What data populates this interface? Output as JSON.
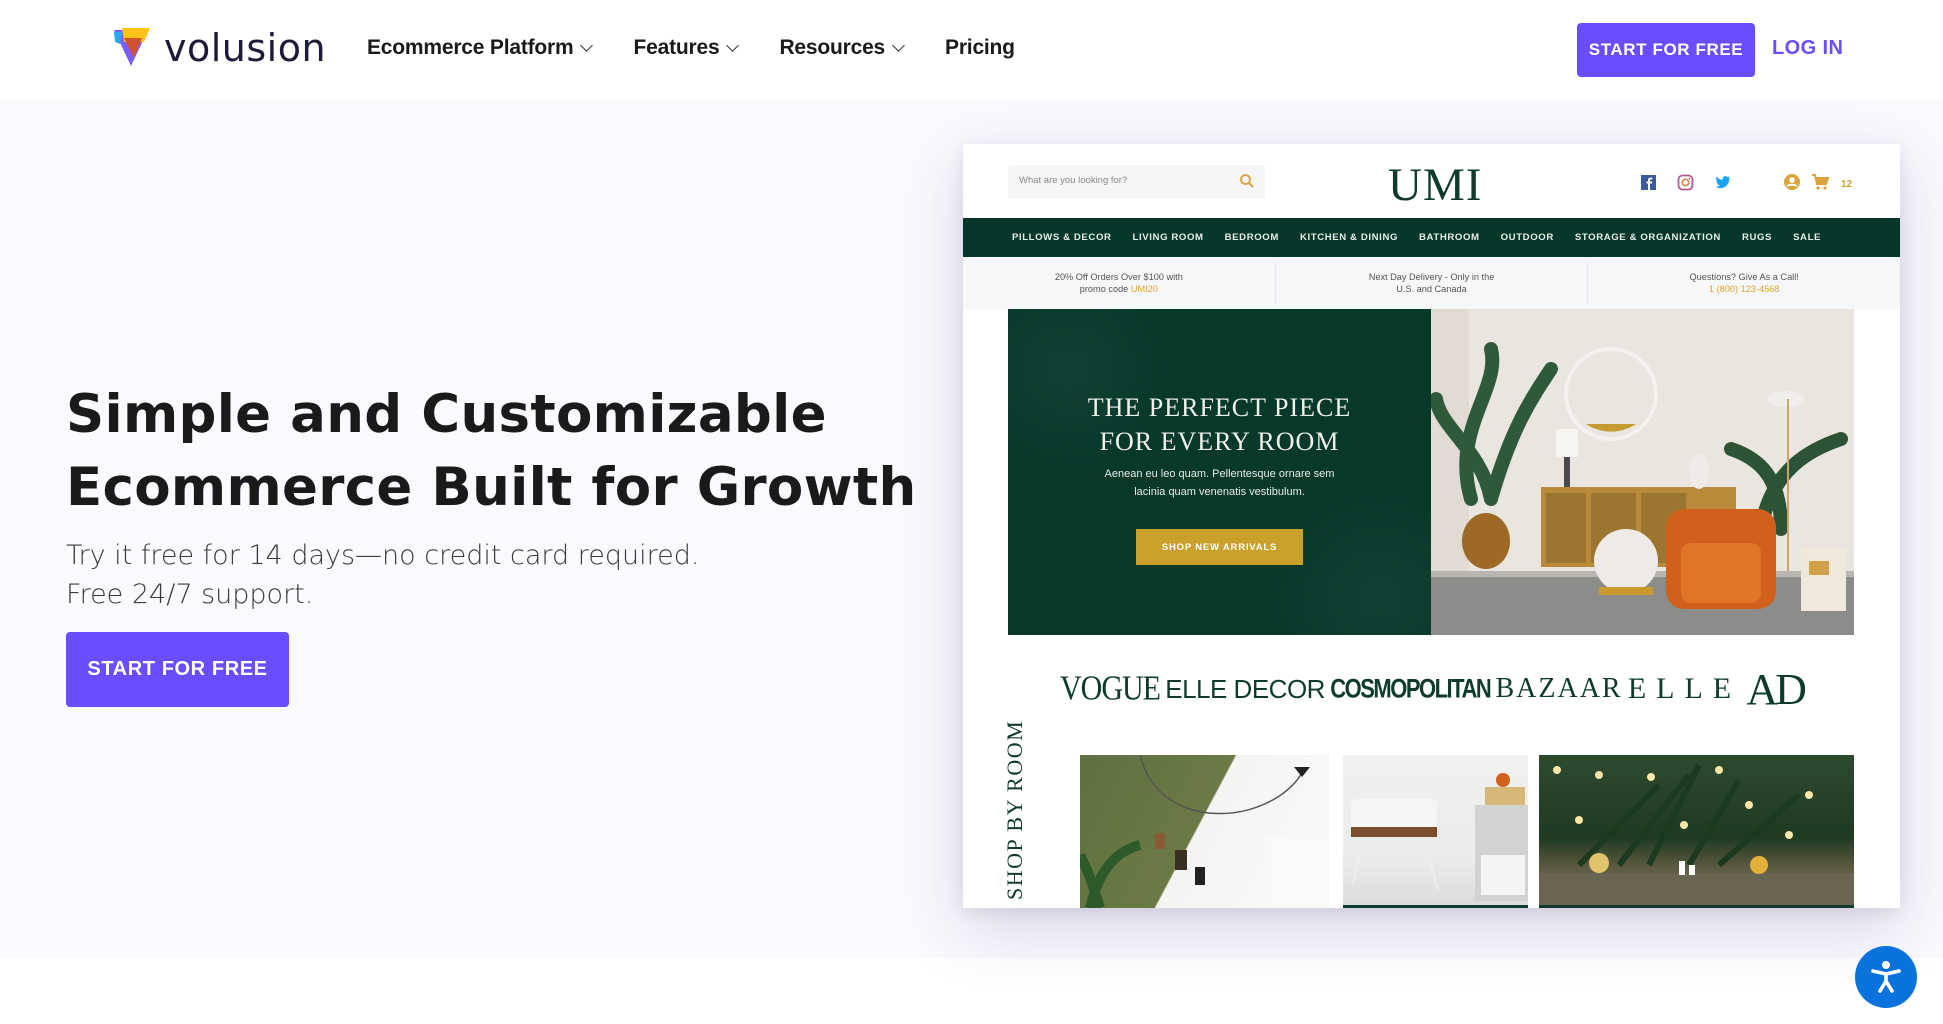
{
  "header": {
    "logo_text": "volusion",
    "nav": [
      {
        "label": "Ecommerce Platform",
        "has_dropdown": true
      },
      {
        "label": "Features",
        "has_dropdown": true
      },
      {
        "label": "Resources",
        "has_dropdown": true
      },
      {
        "label": "Pricing",
        "has_dropdown": false
      }
    ],
    "cta_label": "START FOR FREE",
    "login_label": "LOG IN"
  },
  "hero": {
    "headline_line1": "Simple and Customizable",
    "headline_line2": "Ecommerce Built for Growth",
    "sub_line1": "Try it free for 14 days—no credit card required.",
    "sub_line2": "Free 24/7 support.",
    "cta_label": "START FOR FREE"
  },
  "mockup": {
    "search_placeholder": "What are you looking for?",
    "store_logo": "UMI",
    "social_icons": [
      "facebook-icon",
      "instagram-icon",
      "twitter-icon"
    ],
    "cart_count": "12",
    "nav": [
      "PILLOWS & DECOR",
      "LIVING ROOM",
      "BEDROOM",
      "KITCHEN & DINING",
      "BATHROOM",
      "OUTDOOR",
      "STORAGE & ORGANIZATION",
      "RUGS",
      "SALE"
    ],
    "promos": [
      {
        "line1": "20% Off Orders Over $100 with",
        "line2_prefix": "promo code ",
        "line2_highlight": "UMI20"
      },
      {
        "line1": "Next Day Delivery - Only in the",
        "line2_prefix": "U.S. and Canada",
        "line2_highlight": ""
      },
      {
        "line1": "Questions? Give As a Call!",
        "line2_prefix": "",
        "line2_highlight": "1 (800) 123-4568"
      }
    ],
    "banner": {
      "title_line1": "THE PERFECT PIECE",
      "title_line2": "FOR EVERY ROOM",
      "body_line1": "Aenean eu leo quam. Pellentesque ornare sem",
      "body_line2": "lacinia quam venenatis vestibulum.",
      "button_label": "SHOP NEW ARRIVALS"
    },
    "press": [
      "VOGUE",
      "ELLE DECOR",
      "COSMOPOLITAN",
      "BAZAAR",
      "ELLE",
      "AD"
    ],
    "shop_by_room_label": "SHOP BY ROOM"
  },
  "colors": {
    "brand_purple": "#6a4dff",
    "hero_bg": "#faf9fe",
    "umi_green": "#05372a",
    "umi_gold": "#c9a02a",
    "a11y_blue": "#0a72dd"
  }
}
